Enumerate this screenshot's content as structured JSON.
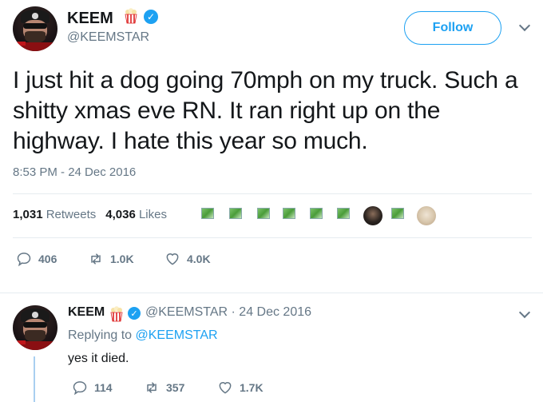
{
  "tweet": {
    "author_name": "KEEM",
    "author_handle": "@KEEMSTAR",
    "follow_label": "Follow",
    "text": "I just hit a dog going 70mph on my truck. Such a shitty xmas eve RN. It ran right up on the highway. I hate this year so much.",
    "timestamp": "8:53 PM - 24 Dec 2016",
    "retweets_count": "1,031",
    "retweets_label": "Retweets",
    "likes_count": "4,036",
    "likes_label": "Likes",
    "actions": {
      "replies": "406",
      "retweets": "1.0K",
      "likes": "4.0K"
    }
  },
  "reply": {
    "author_name": "KEEM",
    "handle_and_date": "@KEEMSTAR · 24 Dec 2016",
    "replying_prefix": "Replying to",
    "replying_to": "@KEEMSTAR",
    "text": "yes it died.",
    "actions": {
      "replies": "114",
      "retweets": "357",
      "likes": "1.7K"
    }
  },
  "icons": {
    "verified": "verified-badge-icon",
    "popcorn": "popcorn-emoji-icon",
    "caret": "chevron-down-icon",
    "reply": "reply-icon",
    "retweet": "retweet-icon",
    "like": "heart-icon"
  },
  "colors": {
    "accent": "#1da1f2",
    "muted": "#657786",
    "text": "#14171a",
    "divider": "#e6ecf0"
  }
}
